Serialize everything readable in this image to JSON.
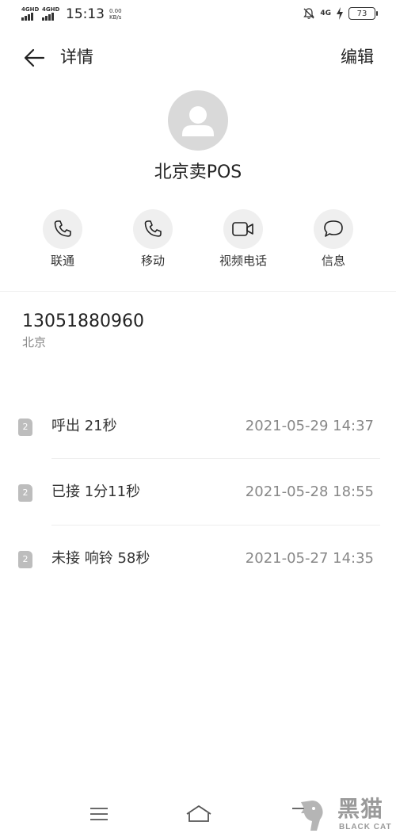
{
  "status_bar": {
    "sim1_tag": "4GHD",
    "sim2_tag": "4GHD",
    "time": "15:13",
    "speed_value": "0.00",
    "speed_unit": "KB/s",
    "network": "4G",
    "battery": "73"
  },
  "header": {
    "title": "详情",
    "edit_label": "编辑"
  },
  "contact": {
    "name": "北京卖POS",
    "phone": "13051880960",
    "region": "北京"
  },
  "actions": [
    {
      "label": "联通",
      "icon": "phone-icon"
    },
    {
      "label": "移动",
      "icon": "phone-icon"
    },
    {
      "label": "视频电话",
      "icon": "video-icon"
    },
    {
      "label": "信息",
      "icon": "message-icon"
    }
  ],
  "call_log": [
    {
      "sim": "2",
      "type": "呼出 21秒",
      "time": "2021-05-29 14:37"
    },
    {
      "sim": "2",
      "type": "已接 1分11秒",
      "time": "2021-05-28 18:55"
    },
    {
      "sim": "2",
      "type": "未接 响铃 58秒",
      "time": "2021-05-27 14:35"
    }
  ],
  "watermark": {
    "text_cn": "黑猫",
    "text_en": "BLACK CAT"
  }
}
